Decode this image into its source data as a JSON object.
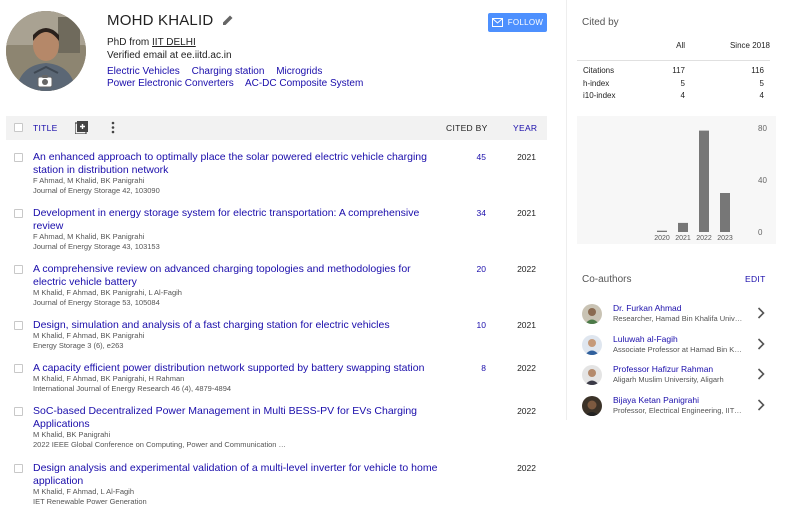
{
  "profile": {
    "name": "MOHD KHALID",
    "affiliation_prefix": "PhD from ",
    "affiliation_link": "IIT DELHI",
    "verified_email": "Verified email at ee.iitd.ac.in",
    "follow_label": "FOLLOW",
    "interests": [
      "Electric Vehicles",
      "Charging station",
      "Microgrids",
      "Power Electronic Converters",
      "AC-DC Composite System"
    ]
  },
  "table": {
    "title_label": "TITLE",
    "cited_by_label": "CITED BY",
    "year_label": "YEAR"
  },
  "articles": [
    {
      "title": "An enhanced approach to optimally place the solar powered electric vehicle charging station in distribution network",
      "authors": "F Ahmad, M Khalid, BK Panigrahi",
      "venue": "Journal of Energy Storage 42, 103090",
      "cited_by": "45",
      "year": "2021"
    },
    {
      "title": "Development in energy storage system for electric transportation: A comprehensive review",
      "authors": "F Ahmad, M Khalid, BK Panigrahi",
      "venue": "Journal of Energy Storage 43, 103153",
      "cited_by": "34",
      "year": "2021"
    },
    {
      "title": "A comprehensive review on advanced charging topologies and methodologies for electric vehicle battery",
      "authors": "M Khalid, F Ahmad, BK Panigrahi, L Al-Fagih",
      "venue": "Journal of Energy Storage 53, 105084",
      "cited_by": "20",
      "year": "2022"
    },
    {
      "title": "Design, simulation and analysis of a fast charging station for electric vehicles",
      "authors": "M Khalid, F Ahmad, BK Panigrahi",
      "venue": "Energy Storage 3 (6), e263",
      "cited_by": "10",
      "year": "2021"
    },
    {
      "title": "A capacity efficient power distribution network supported by battery swapping station",
      "authors": "M Khalid, F Ahmad, BK Panigrahi, H Rahman",
      "venue": "International Journal of Energy Research 46 (4), 4879-4894",
      "cited_by": "8",
      "year": "2022"
    },
    {
      "title": "SoC-based Decentralized Power Management in Multi BESS-PV for EVs Charging Applications",
      "authors": "M Khalid, BK Panigrahi",
      "venue": "2022 IEEE Global Conference on Computing, Power and Communication …",
      "cited_by": "",
      "year": "2022"
    },
    {
      "title": "Design analysis and experimental validation of a multi-level inverter for vehicle to home application",
      "authors": "M Khalid, F Ahmad, L Al-Fagih",
      "venue": "IET Renewable Power Generation",
      "cited_by": "",
      "year": "2022"
    }
  ],
  "cited_by": {
    "title": "Cited by",
    "col_all": "All",
    "col_since": "Since 2018",
    "rows": [
      {
        "label": "Citations",
        "all": "117",
        "since": "116"
      },
      {
        "label": "h-index",
        "all": "5",
        "since": "5"
      },
      {
        "label": "i10-index",
        "all": "4",
        "since": "4"
      }
    ]
  },
  "chart_data": {
    "type": "bar",
    "categories": [
      "2020",
      "2021",
      "2022",
      "2023"
    ],
    "values": [
      1,
      7,
      78,
      30
    ],
    "ylim": [
      0,
      80
    ],
    "yticks": [
      0,
      40,
      80
    ],
    "bar_color": "#777777"
  },
  "coauthors": {
    "title": "Co-authors",
    "edit_label": "EDIT",
    "items": [
      {
        "name": "Dr. Furkan Ahmad",
        "affiliation": "Researcher, Hamad Bin Khalifa University"
      },
      {
        "name": "Luluwah al-Fagih",
        "affiliation": "Associate Professor at Hamad Bin Khalifa University"
      },
      {
        "name": "Professor Hafizur Rahman",
        "affiliation": "Aligarh Muslim University, Aligarh"
      },
      {
        "name": "Bijaya Ketan Panigrahi",
        "affiliation": "Professor, Electrical Engineering, IIT Delhi"
      }
    ]
  },
  "colors": {
    "link": "#1a0dab",
    "follow_button": "#4d90fe",
    "header_bg": "#f2f2f2"
  }
}
